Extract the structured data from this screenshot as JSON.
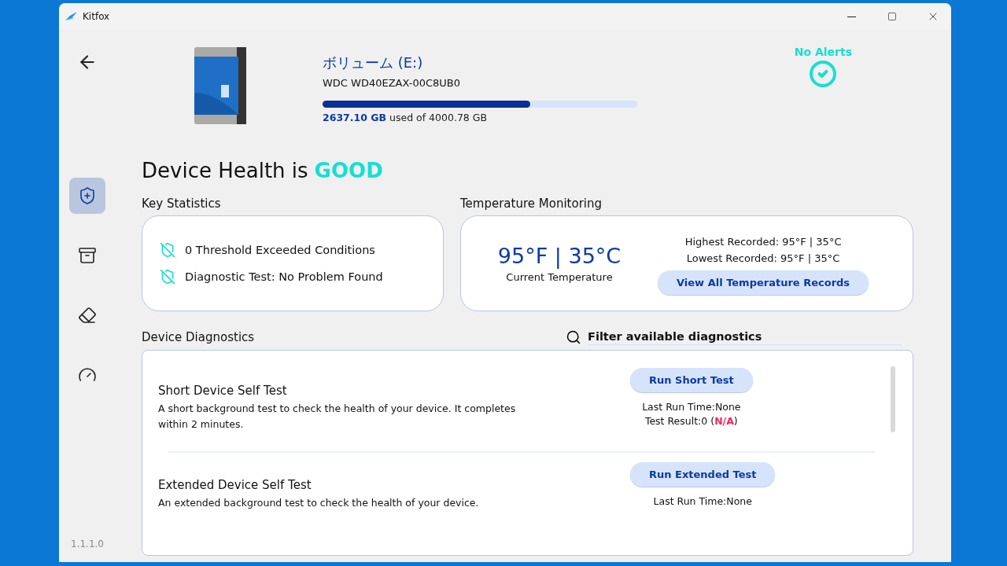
{
  "window": {
    "title": "Kitfox"
  },
  "sidebar": {
    "items": [
      {
        "kind": "health",
        "selected": true
      },
      {
        "kind": "archive",
        "selected": false
      },
      {
        "kind": "erase",
        "selected": false
      },
      {
        "kind": "performance",
        "selected": false
      }
    ],
    "version": "1.1.1.0"
  },
  "device": {
    "name": "ボリューム (E:)",
    "model": "WDC WD40EZAX-00C8UB0",
    "usage": "**2637.10 GB** used of 4000.78 GB",
    "level": 0.66
  },
  "alerts": {
    "text": "No Alerts"
  },
  "health": {
    "prefix": "Device Health is",
    "status": "GOOD"
  },
  "key_statistics": {
    "title": "Key Statistics",
    "items": [
      "0 Threshold Exceeded Conditions",
      "Diagnostic Test: No Problem Found"
    ]
  },
  "temperature": {
    "title": "Temperature Monitoring",
    "current": "95°F | 35°C",
    "current_label": "Current Temperature",
    "highest": "Highest Recorded: 95°F | 35°C",
    "lowest": "Lowest Recorded: 95°F | 35°C",
    "button": "View All Temperature Records"
  },
  "diagnostics": {
    "title": "Device Diagnostics",
    "filter": {
      "placeholder": "Filter available diagnostics"
    },
    "tests": [
      {
        "name": "Short Device Self Test",
        "description": "A short background test to check the health of your device. It completes within 2 minutes.",
        "button": "Run Short Test",
        "last_run": "Last Run Time:None",
        "result": "Test Result:0 (**N/A**)"
      },
      {
        "name": "Extended Device Self Test",
        "description": "An extended background test to check the health of your device.",
        "button": "Run Extended Test",
        "last_run": "Last Run Time:None"
      }
    ]
  }
}
